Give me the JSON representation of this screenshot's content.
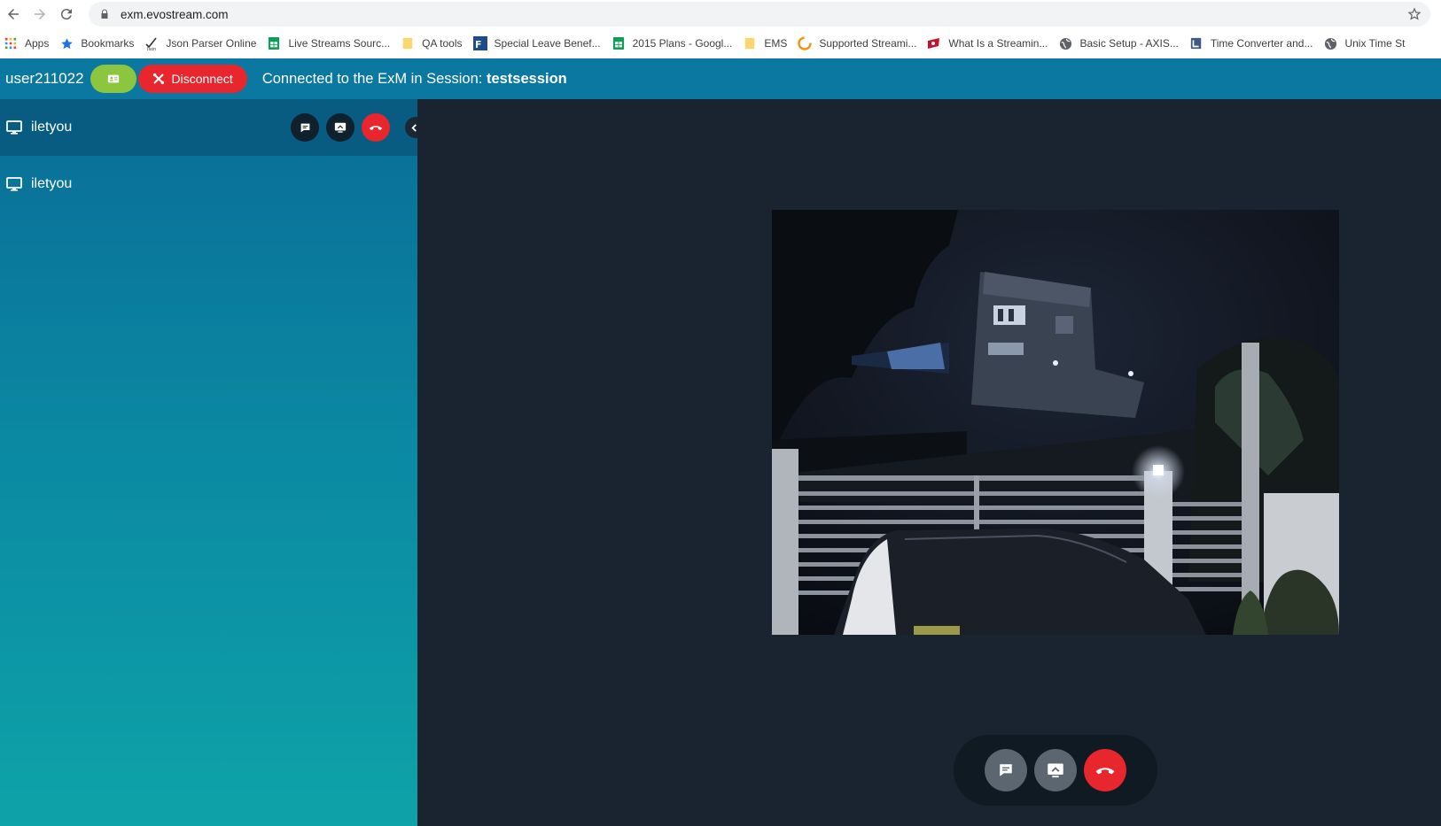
{
  "browser": {
    "url": "exm.evostream.com",
    "bookmarks": [
      {
        "label": "Apps",
        "icon": "apps-grid-icon"
      },
      {
        "label": "Bookmarks",
        "icon": "star-icon"
      },
      {
        "label": "Json Parser Online",
        "icon": "json-icon"
      },
      {
        "label": "Live Streams Sourc...",
        "icon": "sheets-icon"
      },
      {
        "label": "QA tools",
        "icon": "folder-icon"
      },
      {
        "label": "Special Leave Benef...",
        "icon": "form-icon"
      },
      {
        "label": "2015 Plans - Googl...",
        "icon": "sheets-icon"
      },
      {
        "label": "EMS",
        "icon": "folder-icon"
      },
      {
        "label": "Supported Streami...",
        "icon": "swirl-icon"
      },
      {
        "label": "What Is a Streamin...",
        "icon": "red-logo-icon"
      },
      {
        "label": "Basic Setup - AXIS...",
        "icon": "globe-icon"
      },
      {
        "label": "Time Converter and...",
        "icon": "doc-icon"
      },
      {
        "label": "Unix Time St",
        "icon": "globe-icon"
      }
    ]
  },
  "appbar": {
    "username": "user211022",
    "disconnect_label": "Disconnect",
    "connection_prefix": "Connected to the ExM in Session: ",
    "session_name": "testsession"
  },
  "sidebar": {
    "peers": [
      {
        "name": "iletyou",
        "active": true
      },
      {
        "name": "iletyou",
        "active": false
      }
    ]
  },
  "colors": {
    "appbar": "#0a78a0",
    "green_button": "#8cc63f",
    "red_button": "#e8262d",
    "stage": "#1a2330"
  }
}
